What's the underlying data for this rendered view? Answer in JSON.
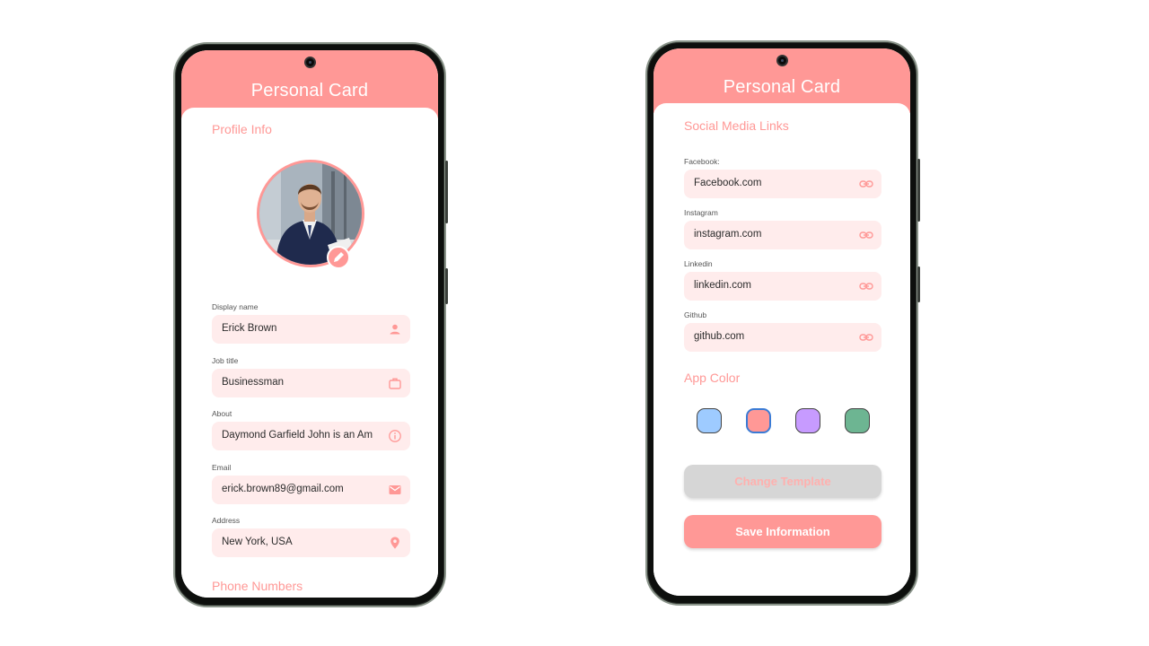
{
  "colors": {
    "accent": "#ff9896",
    "field_bg": "#ffecec",
    "swatches": [
      "#9ecbff",
      "#ff9896",
      "#c79bff",
      "#6db592"
    ]
  },
  "left_phone": {
    "app_title": "Personal Card",
    "section_profile": "Profile Info",
    "avatar_icon": "person-photo",
    "edit_icon": "pencil-icon",
    "fields": [
      {
        "label": "Display name",
        "value": "Erick Brown",
        "icon": "person-icon"
      },
      {
        "label": "Job title",
        "value": "Businessman",
        "icon": "briefcase-icon"
      },
      {
        "label": "About",
        "value": "Daymond Garfield John is an Am",
        "icon": "info-icon"
      },
      {
        "label": "Email",
        "value": "erick.brown89@gmail.com",
        "icon": "mail-icon"
      },
      {
        "label": "Address",
        "value": "New York, USA",
        "icon": "location-pin-icon"
      }
    ],
    "section_phone": "Phone Numbers"
  },
  "right_phone": {
    "app_title": "Personal Card",
    "section_social": "Social Media Links",
    "links": [
      {
        "label": "Facebook:",
        "value": "Facebook.com",
        "icon": "link-icon"
      },
      {
        "label": "Instagram",
        "value": "instagram.com",
        "icon": "link-icon"
      },
      {
        "label": "Linkedin",
        "value": "linkedin.com",
        "icon": "link-icon"
      },
      {
        "label": "Github",
        "value": "github.com",
        "icon": "link-icon"
      }
    ],
    "section_color": "App Color",
    "selected_color_index": 1,
    "change_template_label": "Change Template",
    "save_label": "Save Information"
  }
}
